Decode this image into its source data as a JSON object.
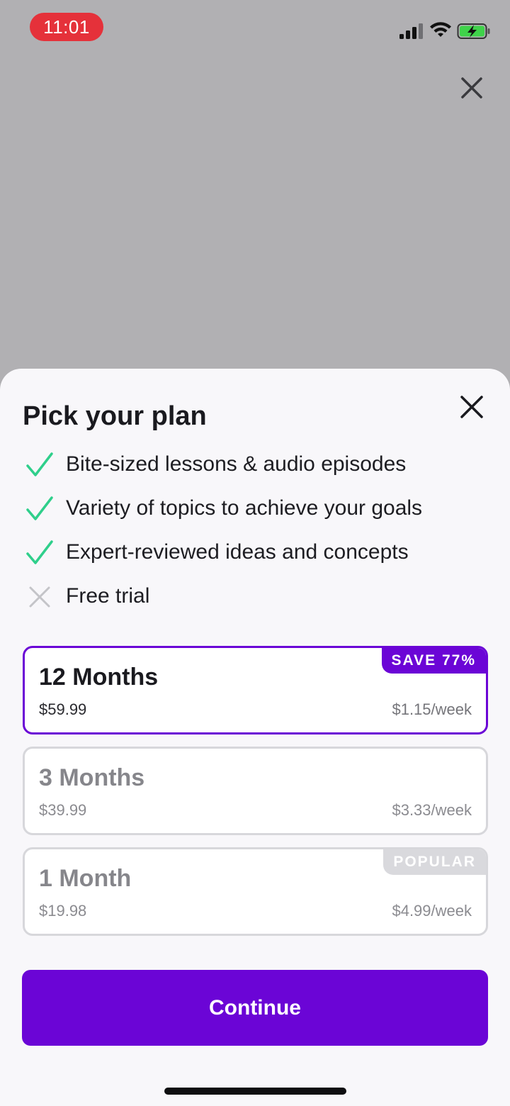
{
  "status_bar": {
    "time": "11:01",
    "time_pill_color": "#e5313a",
    "icons": [
      "signal-icon",
      "wifi-icon",
      "battery-charging-icon"
    ]
  },
  "sheet": {
    "title": "Pick your plan",
    "features": [
      {
        "text": "Bite-sized lessons & audio episodes",
        "icon": "check-icon"
      },
      {
        "text": "Variety of topics to achieve your goals",
        "icon": "check-icon"
      },
      {
        "text": "Expert-reviewed ideas and concepts",
        "icon": "check-icon"
      },
      {
        "text": "Free trial",
        "icon": "cross-icon"
      }
    ],
    "plans": [
      {
        "name": "12 Months",
        "price": "$59.99",
        "per_week": "$1.15/week",
        "badge": "SAVE 77%",
        "selected": true
      },
      {
        "name": "3 Months",
        "price": "$39.99",
        "per_week": "$3.33/week",
        "badge": "",
        "selected": false
      },
      {
        "name": "1 Month",
        "price": "$19.98",
        "per_week": "$4.99/week",
        "badge": "POPULAR",
        "selected": false
      }
    ],
    "continue_label": "Continue"
  },
  "colors": {
    "accent": "#6b05d6",
    "check": "#2fcf8b",
    "cross": "#c4c4c8",
    "overlay": "#b1b0b3"
  }
}
